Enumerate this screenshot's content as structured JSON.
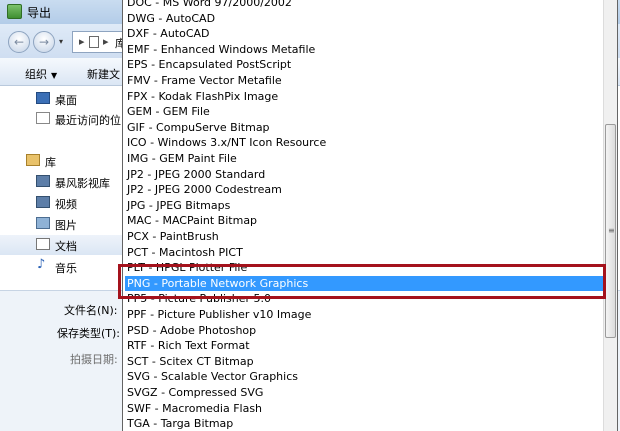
{
  "dialog": {
    "title": "导出",
    "address": {
      "back": "←",
      "forward": "→",
      "dropdown": "▾",
      "separator": "▸",
      "text": "库"
    },
    "toolbar": {
      "organize": "组织",
      "organize_caret": "▼",
      "new_folder": "新建文"
    },
    "nav": [
      {
        "label": "桌面",
        "icon": "desktop-icon"
      },
      {
        "label": "最近访问的位",
        "icon": "recent-places-icon"
      },
      {
        "label": "库",
        "icon": "library-icon"
      },
      {
        "label": "暴风影视库",
        "icon": "media-library-icon"
      },
      {
        "label": "视频",
        "icon": "video-icon"
      },
      {
        "label": "图片",
        "icon": "pictures-icon"
      },
      {
        "label": "文档",
        "icon": "documents-icon"
      },
      {
        "label": "音乐",
        "icon": "music-icon",
        "glyph": "♪"
      }
    ],
    "fields": {
      "filename": "文件名(N):",
      "save_type": "保存类型(T):",
      "date": "拍摄日期:"
    }
  },
  "file_types": {
    "items": [
      "DOC - MS Word 97/2000/2002",
      "DWG - AutoCAD",
      "DXF - AutoCAD",
      "EMF - Enhanced Windows Metafile",
      "EPS - Encapsulated PostScript",
      "FMV - Frame Vector Metafile",
      "FPX - Kodak FlashPix Image",
      "GEM - GEM File",
      "GIF - CompuServe Bitmap",
      "ICO - Windows 3.x/NT Icon Resource",
      "IMG - GEM Paint File",
      "JP2 - JPEG 2000 Standard",
      "JP2 - JPEG 2000 Codestream",
      "JPG - JPEG Bitmaps",
      "MAC - MACPaint Bitmap",
      "PCX - PaintBrush",
      "PCT - Macintosh PICT",
      "PLT - HPGL Plotter File",
      "PNG - Portable Network Graphics",
      "PP5 - Picture Publisher 5.0",
      "PPF - Picture Publisher v10 Image",
      "PSD - Adobe Photoshop",
      "RTF - Rich Text Format",
      "SCT - Scitex CT Bitmap",
      "SVG - Scalable Vector Graphics",
      "SVGZ - Compressed SVG",
      "SWF - Macromedia Flash",
      "TGA - Targa Bitmap"
    ],
    "selected": "PNG - Portable Network Graphics",
    "scroll_grip": "≡"
  },
  "colors": {
    "selection": "#3399ff",
    "highlight_border": "#a4121c"
  }
}
